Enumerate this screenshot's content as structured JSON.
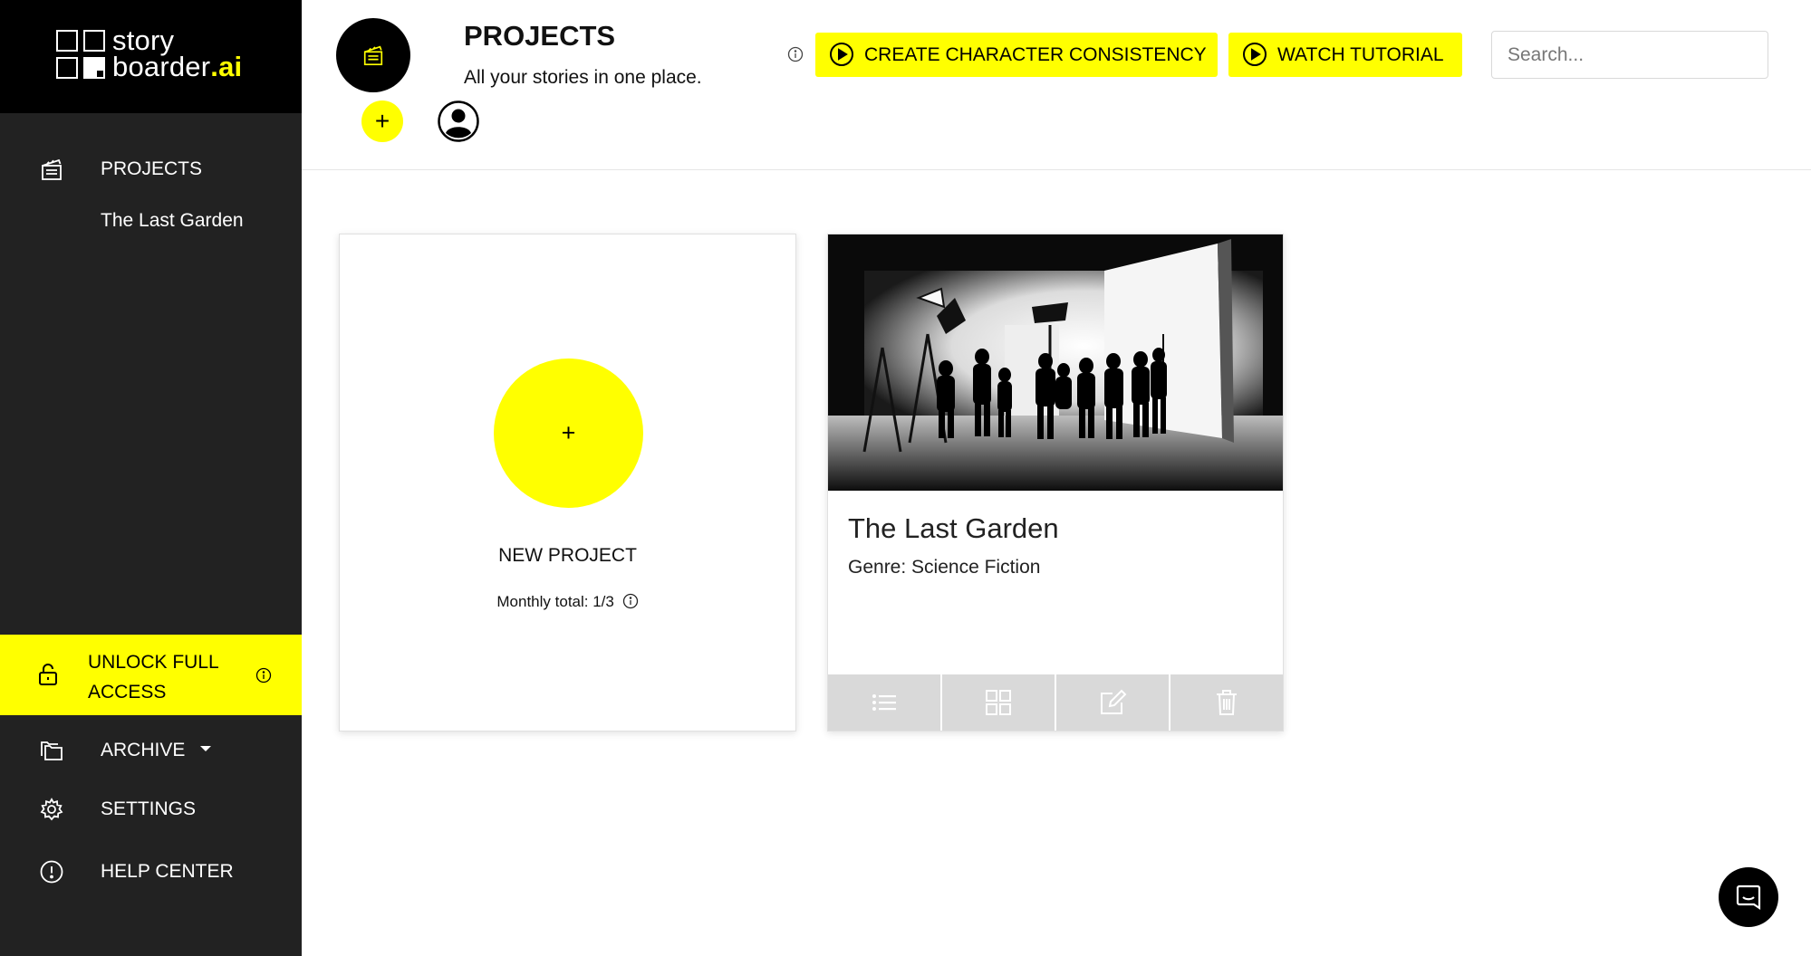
{
  "brand": {
    "logo_line1": "story",
    "logo_line2": "boarder",
    "logo_suffix": ".ai",
    "accent_color": "#ffff00"
  },
  "sidebar": {
    "projects_label": "PROJECTS",
    "projects_icon": "clapperboard-icon",
    "sub_items": [
      {
        "label": "The Last Garden"
      }
    ],
    "unlock_label": "UNLOCK FULL ACCESS",
    "unlock_icon": "lock-icon",
    "archive_label": "ARCHIVE",
    "archive_icon": "folders-icon",
    "settings_label": "SETTINGS",
    "settings_icon": "gear-icon",
    "help_label": "HELP CENTER",
    "help_icon": "exclamation-circle-icon"
  },
  "header": {
    "title": "PROJECTS",
    "subtitle": "All your stories in one place.",
    "character_button": "CREATE CHARACTER CONSISTENCY",
    "tutorial_button": "WATCH TUTORIAL",
    "search_placeholder": "Search...",
    "add_label": "+"
  },
  "new_project": {
    "plus": "+",
    "label": "NEW PROJECT",
    "monthly_total": "Monthly total: 1/3"
  },
  "projects": [
    {
      "title": "The Last Garden",
      "genre": "Genre: Science Fiction",
      "actions": [
        "list-icon",
        "grid-icon",
        "edit-icon",
        "trash-icon"
      ]
    }
  ]
}
